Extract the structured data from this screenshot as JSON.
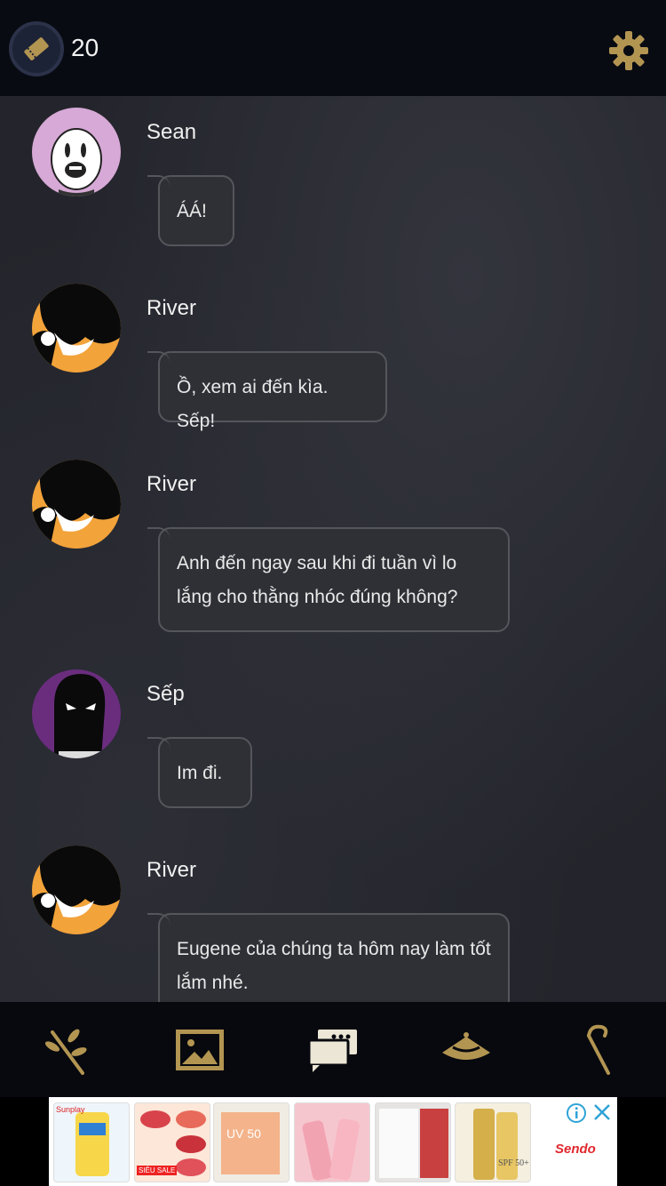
{
  "header": {
    "ticket_icon": "ticket-icon",
    "ticket_count": "20",
    "settings_icon": "gear-icon"
  },
  "messages": [
    {
      "name": "Sean",
      "text": "ÁÁ!",
      "avatar": "sean-avatar"
    },
    {
      "name": "River",
      "text": "Ồ, xem ai đến kìa. Sếp!",
      "avatar": "river-avatar"
    },
    {
      "name": "River",
      "text": "Anh đến ngay sau khi đi tuần vì lo lắng cho thằng nhóc đúng không?",
      "avatar": "river-avatar"
    },
    {
      "name": "Sếp",
      "text": "Im đi.",
      "avatar": "sep-avatar"
    },
    {
      "name": "River",
      "text": "Eugene của chúng ta hôm nay làm tốt lắm nhé.",
      "avatar": "river-avatar"
    }
  ],
  "nav": [
    {
      "icon": "branch-icon",
      "active": false
    },
    {
      "icon": "image-gallery-icon",
      "active": false
    },
    {
      "icon": "chat-icon",
      "active": true
    },
    {
      "icon": "hat-icon",
      "active": false
    },
    {
      "icon": "cane-icon",
      "active": false
    }
  ],
  "ad": {
    "brand": "Sendo",
    "tiles": [
      "Sunplay",
      "SIÊU SALE",
      "UV 50",
      "",
      "",
      "SPF 50+"
    ]
  },
  "colors": {
    "accent": "#b39552",
    "background": "#24252c",
    "bubble": "#2f3036",
    "topbar": "#080b12"
  }
}
